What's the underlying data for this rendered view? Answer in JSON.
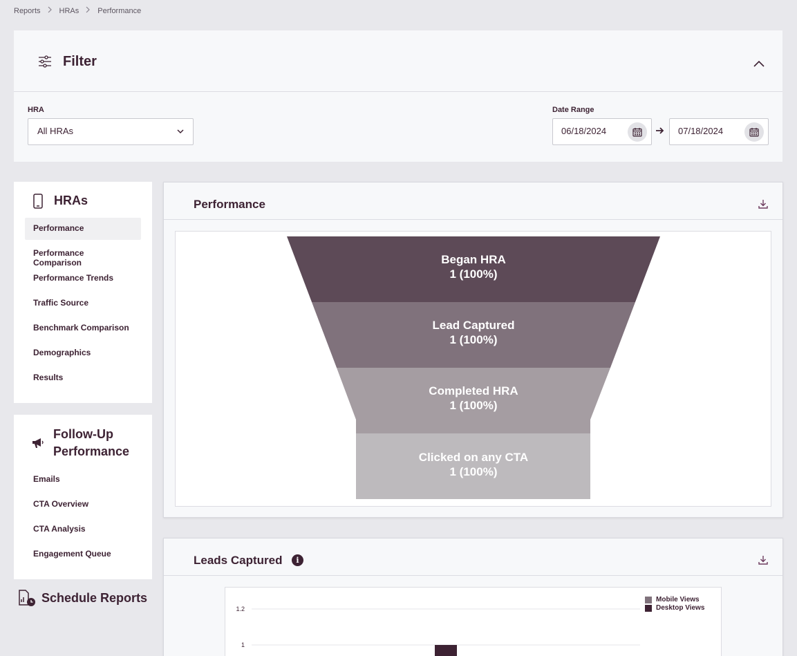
{
  "breadcrumb": [
    "Reports",
    "HRAs",
    "Performance"
  ],
  "filter": {
    "title": "Filter",
    "hra_label": "HRA",
    "hra_value": "All HRAs",
    "date_label": "Date Range",
    "date_start": "06/18/2024",
    "date_end": "07/18/2024"
  },
  "sidebar": {
    "hras_heading": "HRAs",
    "hras_items": [
      {
        "label": "Performance",
        "active": true
      },
      {
        "label": "Performance Comparison"
      },
      {
        "label": "Performance Trends"
      },
      {
        "label": "Traffic Source"
      },
      {
        "label": "Benchmark Comparison"
      },
      {
        "label": "Demographics"
      },
      {
        "label": "Results"
      }
    ],
    "followup_heading_1": "Follow-Up",
    "followup_heading_2": "Performance",
    "followup_items": [
      {
        "label": "Emails"
      },
      {
        "label": "CTA Overview"
      },
      {
        "label": "CTA Analysis"
      },
      {
        "label": "Engagement Queue"
      }
    ],
    "schedule_label": "Schedule Reports"
  },
  "performance": {
    "title": "Performance",
    "funnel": [
      {
        "label": "Began HRA",
        "value": "1 (100%)",
        "color": "#5d4a57"
      },
      {
        "label": "Lead Captured",
        "value": "1 (100%)",
        "color": "#80727c"
      },
      {
        "label": "Completed HRA",
        "value": "1 (100%)",
        "color": "#a59da2"
      },
      {
        "label": "Clicked on any CTA",
        "value": "1 (100%)",
        "color": "#bdbabd"
      }
    ]
  },
  "leads": {
    "title": "Leads Captured",
    "info": "i",
    "chart_data": {
      "type": "bar",
      "series": [
        {
          "name": "Mobile Views",
          "color": "#80727c"
        },
        {
          "name": "Desktop Views",
          "color": "#3d2233"
        }
      ],
      "ytick_labels": [
        "1.2",
        "1"
      ],
      "ylim": [
        0,
        1.2
      ],
      "legend": "top-right"
    }
  }
}
